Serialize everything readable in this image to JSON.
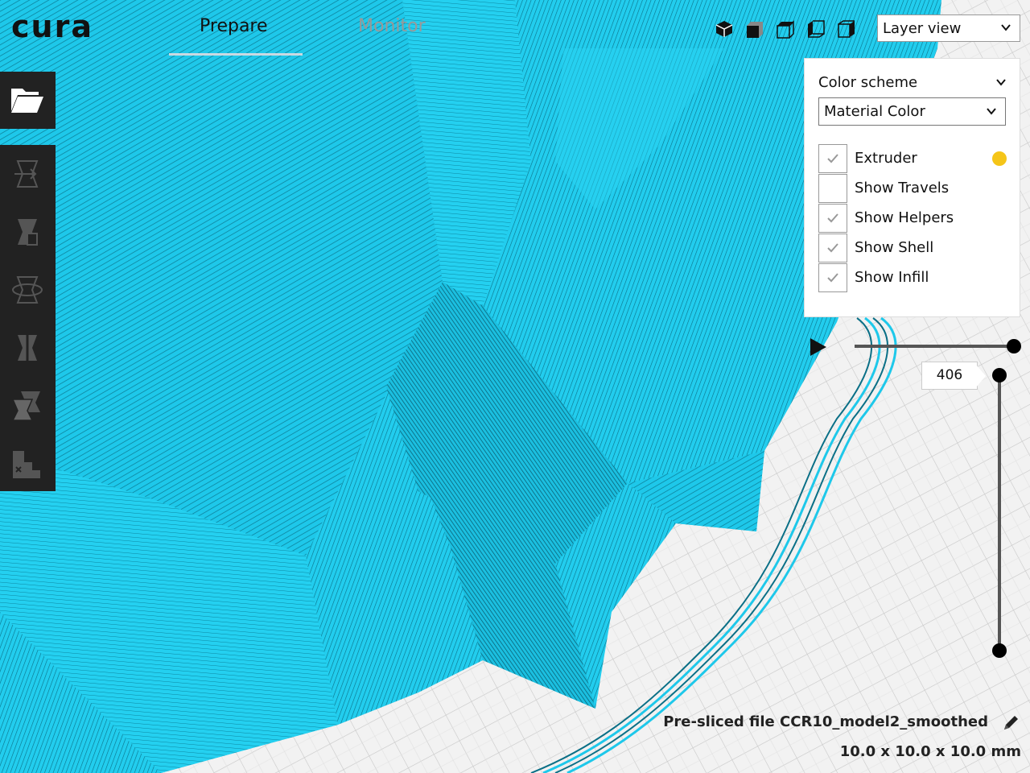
{
  "app": {
    "logo_text": "cura"
  },
  "tabs": [
    {
      "label": "Prepare",
      "active": true
    },
    {
      "label": "Monitor",
      "active": false
    }
  ],
  "view_icons": [
    "3d-view-icon",
    "front-view-icon",
    "top-view-icon",
    "left-view-icon",
    "right-view-icon"
  ],
  "view_mode": {
    "selected": "Layer view"
  },
  "toolbar": {
    "items": [
      "open-folder-icon",
      "move-tool-icon",
      "scale-tool-icon",
      "rotate-tool-icon",
      "mirror-tool-icon",
      "per-model-settings-icon",
      "support-blocker-icon"
    ]
  },
  "color_panel": {
    "title": "Color scheme",
    "scheme_selected": "Material Color",
    "options": [
      {
        "label": "Extruder",
        "checked": true,
        "swatch_color": "#f5c518"
      },
      {
        "label": "Show Travels",
        "checked": false
      },
      {
        "label": "Show Helpers",
        "checked": true
      },
      {
        "label": "Show Shell",
        "checked": true
      },
      {
        "label": "Show Infill",
        "checked": true
      }
    ]
  },
  "layer_slider": {
    "current_layer": "406"
  },
  "job": {
    "file_name": "Pre-sliced file CCR10_model2_smoothed",
    "dimensions": "10.0 x 10.0 x 10.0 mm"
  },
  "colors": {
    "model": "#1ec8ea",
    "model_dark": "#0a6f86",
    "toolbar_bg": "#222222",
    "accent": "#f5c518"
  }
}
